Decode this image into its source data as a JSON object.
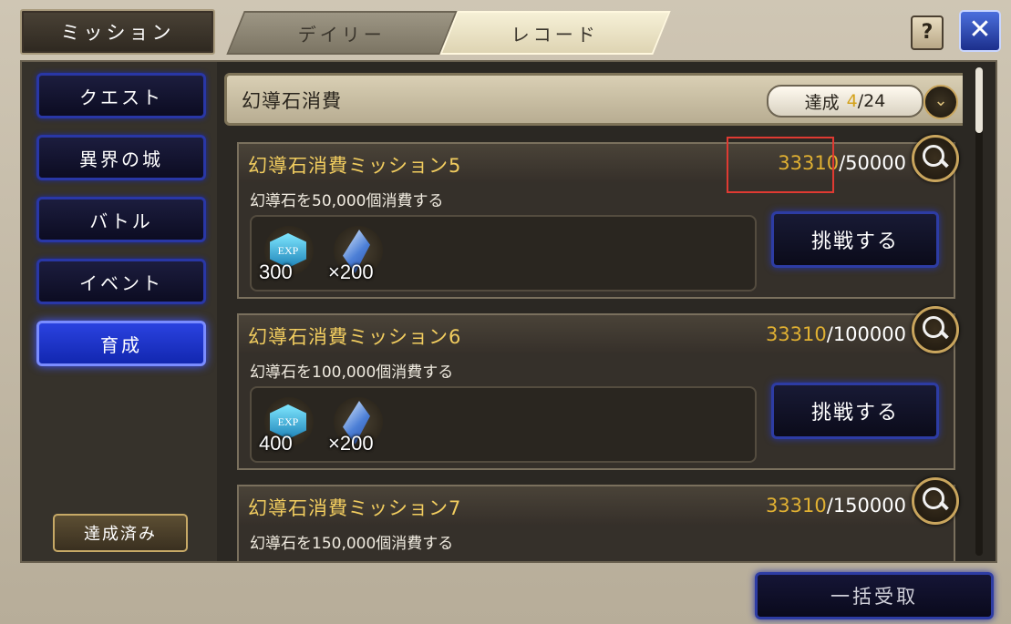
{
  "header": {
    "title": "ミッション",
    "tabs": [
      {
        "label": "デイリー",
        "active": false
      },
      {
        "label": "レコード",
        "active": true
      }
    ],
    "help_icon": "help-icon",
    "close_icon": "close-icon"
  },
  "sidebar": {
    "items": [
      {
        "label": "クエスト",
        "active": false
      },
      {
        "label": "異界の城",
        "active": false
      },
      {
        "label": "バトル",
        "active": false
      },
      {
        "label": "イベント",
        "active": false
      },
      {
        "label": "育成",
        "active": true
      }
    ],
    "completed_label": "達成済み"
  },
  "category": {
    "name": "幻導石消費",
    "progress_label": "達成",
    "progress_current": "4",
    "progress_total": "/24"
  },
  "missions": [
    {
      "title": "幻導石消費ミッション5",
      "current": "33310",
      "target": "/50000",
      "description": "幻導石を50,000個消費する",
      "rewards": [
        {
          "icon": "exp-gem-icon",
          "label": "EXP",
          "qty": "300"
        },
        {
          "icon": "crystal-icon",
          "qty": "×200"
        }
      ],
      "button": "挑戦する"
    },
    {
      "title": "幻導石消費ミッション6",
      "current": "33310",
      "target": "/100000",
      "description": "幻導石を100,000個消費する",
      "rewards": [
        {
          "icon": "exp-gem-icon",
          "label": "EXP",
          "qty": "400"
        },
        {
          "icon": "crystal-icon",
          "qty": "×200"
        }
      ],
      "button": "挑戦する"
    },
    {
      "title": "幻導石消費ミッション7",
      "current": "33310",
      "target": "/150000",
      "description": "幻導石を150,000個消費する"
    }
  ],
  "footer": {
    "bulk_receive": "一括受取"
  },
  "colors": {
    "accent_gold": "#e0b032",
    "button_blue": "#2d3ca4",
    "highlight_red": "#e03a32"
  }
}
